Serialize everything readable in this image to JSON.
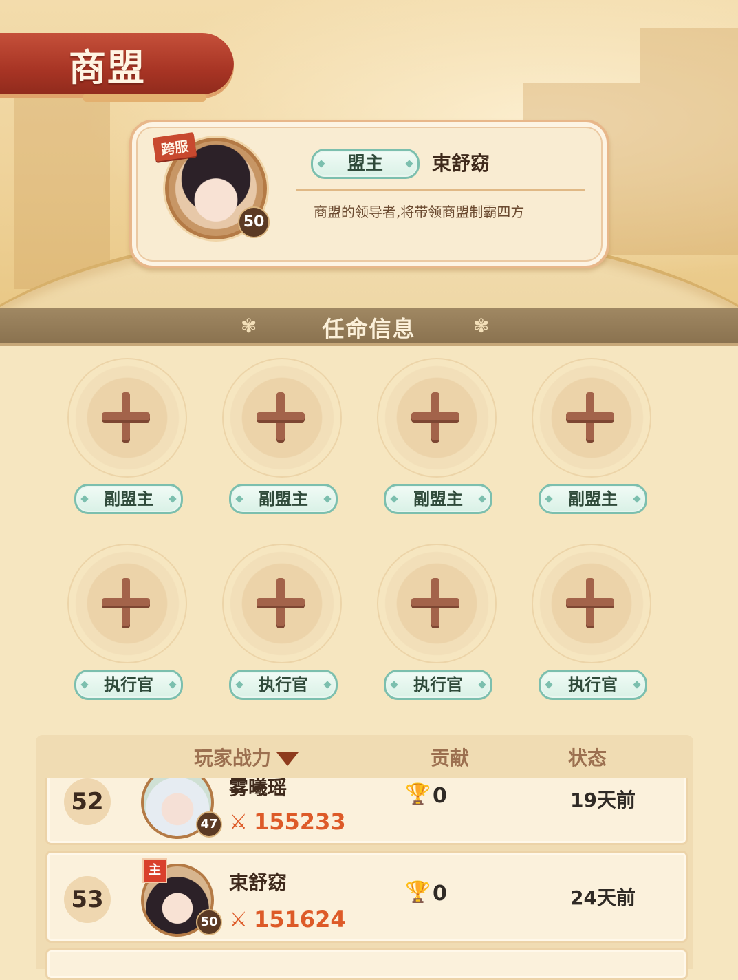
{
  "title": "商盟",
  "leader": {
    "tag": "跨服",
    "level": "50",
    "role": "盟主",
    "name": "束舒窈",
    "description": "商盟的领导者,将带领商盟制霸四方"
  },
  "appointment": {
    "title": "任命信息",
    "flower_icon": "flower-ornament-icon",
    "add_icon": "plus-icon",
    "vice_slots": [
      "副盟主",
      "副盟主",
      "副盟主",
      "副盟主"
    ],
    "exec_slots": [
      "执行官",
      "执行官",
      "执行官",
      "执行官"
    ]
  },
  "list": {
    "headers": {
      "power": "玩家战力",
      "contribution": "贡献",
      "status": "状态"
    },
    "rows": [
      {
        "rank": "52",
        "name": "雾曦瑶",
        "level": "47",
        "power": "155233",
        "contribution": "0",
        "status": "19天前"
      },
      {
        "rank": "53",
        "name": "束舒窈",
        "level": "50",
        "power": "151624",
        "contribution": "0",
        "status": "24天前",
        "badge": "主"
      }
    ]
  },
  "colors": {
    "banner": "#a73424",
    "accent_teal": "#7cbfae",
    "power_orange": "#dd5a28"
  }
}
